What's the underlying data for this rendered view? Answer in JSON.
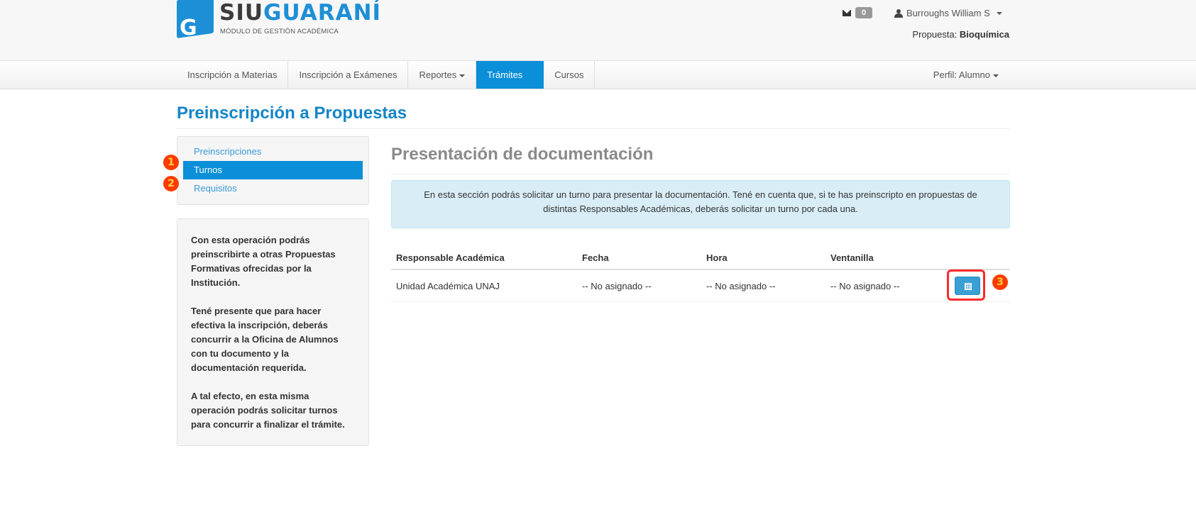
{
  "header": {
    "logo": {
      "siu": "SIU",
      "guarani": "GUARANÍ",
      "subtitle": "MÓDULO DE GESTIÓN ACADÉMICA",
      "tile_letter": "G"
    },
    "mail_count": "0",
    "user_name": "Burroughs William S",
    "propuesta_label": "Propuesta:",
    "propuesta_value": "Bioquímica"
  },
  "nav": {
    "items": [
      {
        "label": "Inscripción a Materias"
      },
      {
        "label": "Inscripción a Exámenes"
      },
      {
        "label": "Reportes"
      },
      {
        "label": "Trámites"
      },
      {
        "label": "Cursos"
      }
    ],
    "perfil": "Perfil: Alumno"
  },
  "page": {
    "title": "Preinscripción a Propuestas"
  },
  "sidebar": {
    "items": [
      {
        "label": "Preinscripciones"
      },
      {
        "label": "Turnos"
      },
      {
        "label": "Requisitos"
      }
    ],
    "info": [
      "Con esta operación podrás preinscribirte a otras Propuestas Formativas ofrecidas por la Institución.",
      "Tené presente que para hacer efectiva la inscripción, deberás concurrir a la Oficina de Alumnos con tu documento y la documentación requerida.",
      "A tal efecto, en esta misma operación podrás solicitar turnos para concurrir a finalizar el trámite."
    ]
  },
  "main": {
    "title": "Presentación de documentación",
    "alert": "En esta sección podrás solicitar un turno para presentar la documentación. Tené en cuenta que, si te has preinscripto en propuestas de distintas Responsables Académicas, deberás solicitar un turno por cada una.",
    "table": {
      "headers": [
        "Responsable Académica",
        "Fecha",
        "Hora",
        "Ventanilla"
      ],
      "rows": [
        [
          "Unidad Académica UNAJ",
          "-- No asignado --",
          "-- No asignado --",
          "-- No asignado --"
        ]
      ]
    }
  },
  "markers": [
    "1",
    "2",
    "3"
  ],
  "colors": {
    "accent": "#0a8fd8",
    "title": "#1585c8",
    "marker": "#ff3b00",
    "highlight": "#ff2a2a"
  }
}
